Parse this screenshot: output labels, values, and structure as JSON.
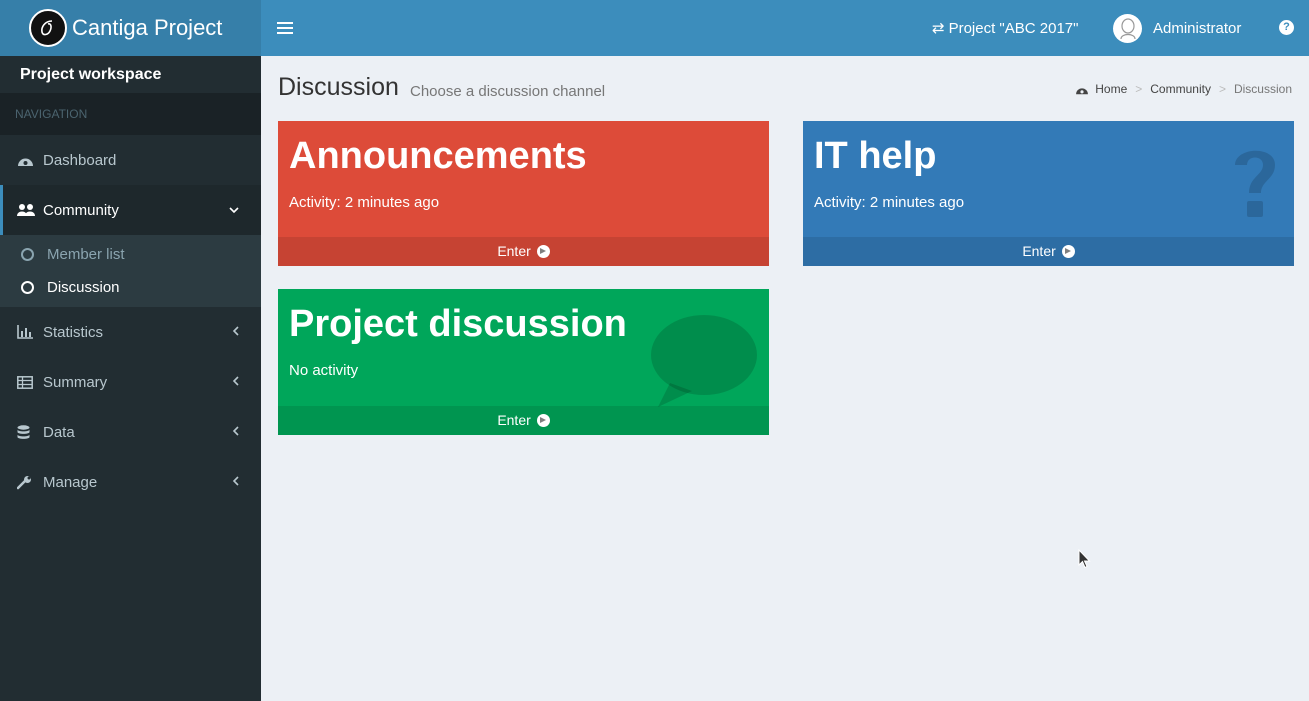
{
  "app": {
    "title": "Cantiga Project"
  },
  "header": {
    "project": "Project \"ABC 2017\"",
    "user": "Administrator",
    "help_icon": "question-circle-icon",
    "colors": {
      "navbar": "#3c8dbc",
      "logo": "#367fa9"
    }
  },
  "sidebar": {
    "workspace": "Project workspace",
    "nav_header": "NAVIGATION",
    "items": [
      {
        "label": "Dashboard",
        "icon": "dashboard-icon"
      },
      {
        "label": "Community",
        "icon": "users-icon"
      },
      {
        "label": "Statistics",
        "icon": "bar-chart-icon"
      },
      {
        "label": "Summary",
        "icon": "table-icon"
      },
      {
        "label": "Data",
        "icon": "database-icon"
      },
      {
        "label": "Manage",
        "icon": "wrench-icon"
      }
    ],
    "community_sub": [
      {
        "label": "Member list"
      },
      {
        "label": "Discussion"
      }
    ]
  },
  "page": {
    "title": "Discussion",
    "subtitle": "Choose a discussion channel",
    "breadcrumb": [
      "Home",
      "Community",
      "Discussion"
    ]
  },
  "channels": [
    {
      "name": "Announcements",
      "activity": "Activity: 2 minutes ago",
      "enter": "Enter",
      "color": "#dd4b39",
      "icon": "microphone-icon"
    },
    {
      "name": "IT help",
      "activity": "Activity: 2 minutes ago",
      "enter": "Enter",
      "color": "#337ab7",
      "icon": "question-icon"
    },
    {
      "name": "Project discussion",
      "activity": "No activity",
      "enter": "Enter",
      "color": "#00a65a",
      "icon": "comment-icon"
    }
  ]
}
